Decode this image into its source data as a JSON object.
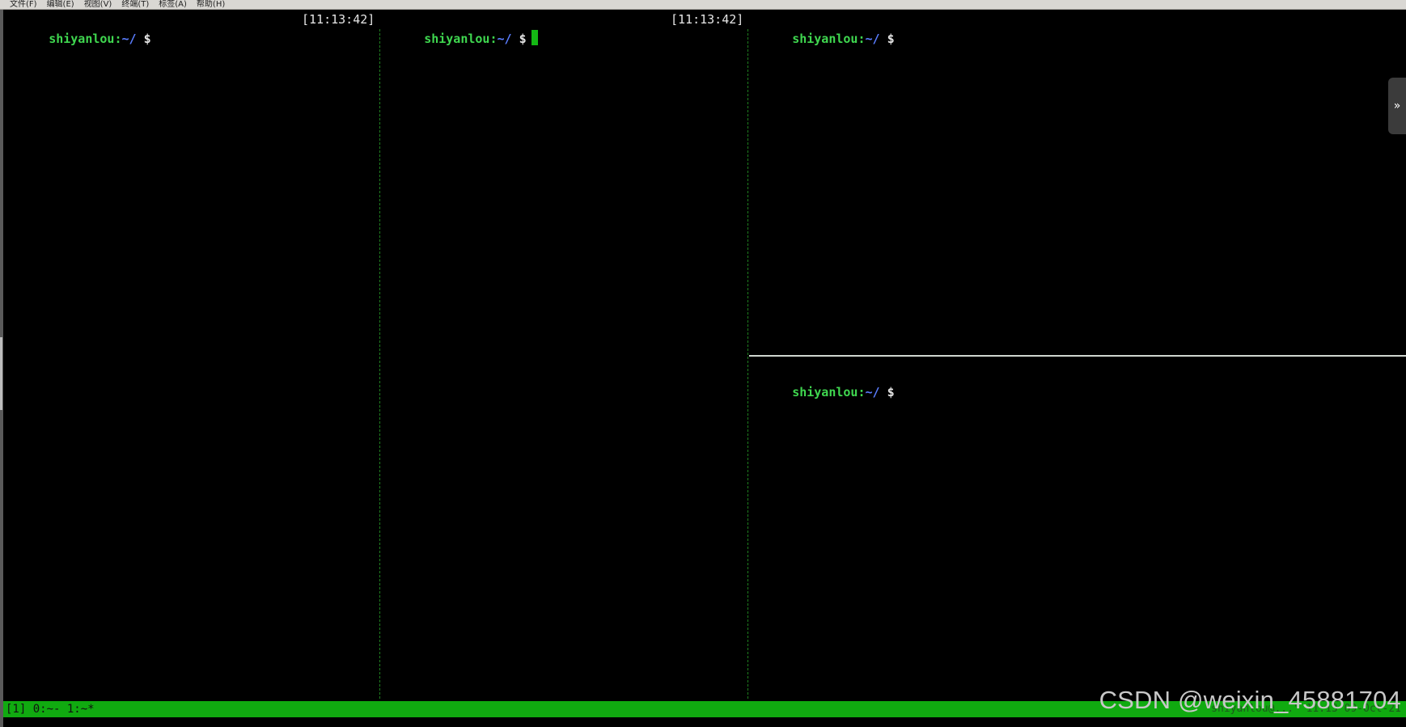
{
  "menubar": {
    "items": [
      "文件(F)",
      "编辑(E)",
      "视图(V)",
      "终端(T)",
      "标签(A)",
      "帮助(H)"
    ]
  },
  "panes": [
    {
      "user": "shiyanlou:",
      "path": "~/",
      "sign": "$",
      "clock": "[11:13:42]"
    },
    {
      "user": "shiyanlou:",
      "path": "~/",
      "sign": "$",
      "clock": "[11:13:42]"
    },
    {
      "user": "shiyanlou:",
      "path": "~/",
      "sign": "$"
    },
    {
      "user": "shiyanlou:",
      "path": "~/",
      "sign": "$"
    }
  ],
  "side_tab": {
    "label": "»"
  },
  "statusbar": {
    "left": "[1] 0:~- 1:~*",
    "right": "\"shiyanlou@...\" 11:13 09-Oct-21"
  },
  "watermark": "CSDN @weixin_45881704",
  "colors": {
    "background": "#000000",
    "prompt_user": "#3fd64f",
    "prompt_path": "#5a7dff",
    "status_bar": "#10aa10",
    "cursor": "#14b814"
  },
  "icons": {
    "side_tab": "double-chevron-right-icon"
  }
}
